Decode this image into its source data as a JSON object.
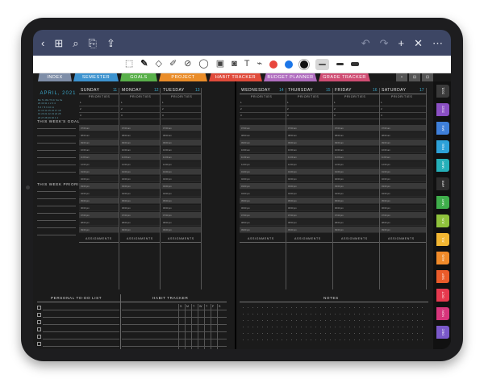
{
  "appbar": {
    "icons_left": [
      "‹",
      "⊞",
      "⌕",
      "⎘",
      "⇪"
    ],
    "icons_right": [
      "↶",
      "↷",
      "+",
      "✕",
      "⋯"
    ]
  },
  "toolbar": {
    "tools": [
      "⬚",
      "✎",
      "◇",
      "✐",
      "⊘",
      "◯",
      "▣",
      "◙",
      "T",
      "⌁"
    ],
    "colors": [
      "#e8453c",
      "#1b76e8",
      "#111111"
    ]
  },
  "tabs": [
    {
      "label": "INDEX",
      "color": "#7f8ea8",
      "w": 42
    },
    {
      "label": "SEMESTER",
      "color": "#3d93cf",
      "w": 56
    },
    {
      "label": "GOALS",
      "color": "#59b04a",
      "w": 46
    },
    {
      "label": "PROJECT",
      "color": "#ea8d29",
      "w": 60
    },
    {
      "label": "HABIT TRACKER",
      "color": "#e04b3b",
      "w": 66
    },
    {
      "label": "BUDGET PLANNER",
      "color": "#b06dbf",
      "w": 66
    },
    {
      "label": "GRADE TRACKER",
      "color": "#cf4d73",
      "w": 64
    }
  ],
  "left": {
    "month_title": "APRIL, 2021",
    "mini_cal": [
      "Mo Tu We Th Fr Sa Su",
      "29 30 31 1 2 3 4",
      "5 6 7 8 9 10 11",
      "12 13 14 15 16 17 18",
      "19 20 21 22 23 24 25",
      "26 27 28 29 30 1 2"
    ],
    "weeks_goal": "THIS WEEK'S GOAL",
    "weeks_priority": "THIS WEEK PRIORITY",
    "days": [
      {
        "name": "SUNDAY",
        "num": "11"
      },
      {
        "name": "MONDAY",
        "num": "12"
      },
      {
        "name": "TUESDAY",
        "num": "13"
      }
    ],
    "priorities": "PRIORITIES",
    "assignments": "ASSIGNMENTS",
    "todo": "PERSONAL TO-DO LIST",
    "habit": "HABIT TRACKER",
    "habit_days": [
      "S",
      "M",
      "T",
      "W",
      "T",
      "F",
      "S"
    ]
  },
  "right": {
    "days": [
      {
        "name": "WEDNESDAY",
        "num": "14"
      },
      {
        "name": "THURSDAY",
        "num": "15"
      },
      {
        "name": "FRIDAY",
        "num": "16"
      },
      {
        "name": "SATURDAY",
        "num": "17"
      }
    ],
    "priorities": "PRIORITIES",
    "assignments": "ASSIGNMENTS",
    "notes": "NOTES"
  },
  "times": [
    "07:00 am",
    "08:00 am",
    "09:00 am",
    "10:00 am",
    "11:00 am",
    "12:00 pm",
    "01:00 pm",
    "02:00 pm",
    "03:00 pm",
    "04:00 pm",
    "05:00 pm",
    "06:00 pm",
    "07:00 pm",
    "08:00 pm",
    "09:00 pm"
  ],
  "sidetabs": [
    {
      "label": "2021",
      "color": "#3a3a3a"
    },
    {
      "label": "2022",
      "color": "#8a4fc2"
    },
    {
      "label": "JAN",
      "color": "#3e7fd9"
    },
    {
      "label": "FEB",
      "color": "#2da1d8"
    },
    {
      "label": "MAR",
      "color": "#25b0b9"
    },
    {
      "label": "APR",
      "color": "#2e2e2e"
    },
    {
      "label": "MAY",
      "color": "#3fae4b"
    },
    {
      "label": "JUN",
      "color": "#8fc23c"
    },
    {
      "label": "JUL",
      "color": "#f2b632"
    },
    {
      "label": "AUG",
      "color": "#f08a29"
    },
    {
      "label": "SEP",
      "color": "#ea5b2a"
    },
    {
      "label": "OCT",
      "color": "#e6394e"
    },
    {
      "label": "NOV",
      "color": "#d7357b"
    },
    {
      "label": "DEC",
      "color": "#7a58c9"
    }
  ]
}
